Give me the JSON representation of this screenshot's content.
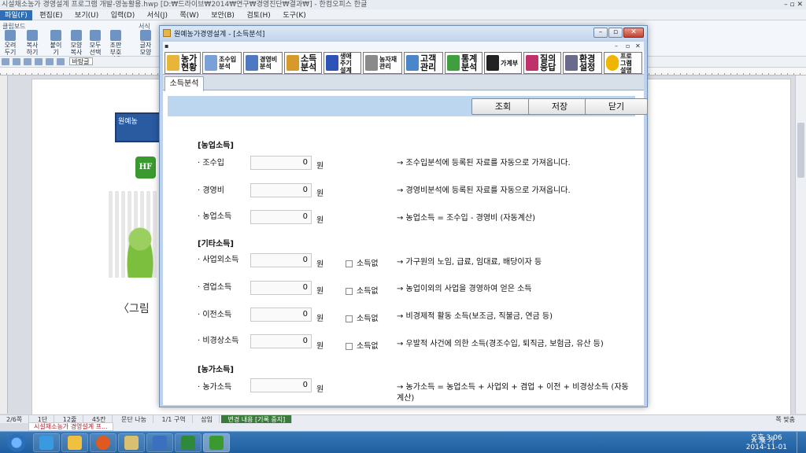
{
  "bg_window": {
    "title": "시설채소농가 경영설계 프로그램 개발-영농활용.hwp [D:₩드라이브₩2014₩연구₩경영진단₩결과₩] - 한컴오피스 한글",
    "menu": [
      "파일(F)",
      "편집(E)",
      "보기(U)",
      "입력(D)",
      "서식(J)",
      "쪽(W)",
      "보안(B)",
      "검토(H)",
      "도구(K)"
    ],
    "ribbon_labels": [
      "클립보드",
      "서식"
    ],
    "ribbon_buttons": [
      "오려두기",
      "복사하기",
      "붙이기",
      "모양복사",
      "모두선택",
      "조판부호지우기",
      "글자모양"
    ],
    "toolbar_field": "바탕글",
    "caption": "〈그림",
    "mini_title": "원예농",
    "logo_text": "HF",
    "status": {
      "page": "2/6쪽",
      "section": "1단",
      "line": "12줄",
      "col": "45칸",
      "paragraph": "문단 나눔",
      "area": "1/1 구역",
      "insert": "삽입",
      "track": "변경 내용 [기록 중지]",
      "doc_tab": "시설채소농가 경영설계 프...",
      "zoom": "쪽 맞춤"
    }
  },
  "taskbar": {
    "tray_text": "A 漢 가",
    "time": "오후 3:06",
    "date": "2014-11-01"
  },
  "dialog": {
    "title": "원예농가경영설계 - [소득분석]",
    "toolbar": [
      {
        "label": "농가\n현황",
        "color": "#e8b53a"
      },
      {
        "label": "조수입\n분석",
        "color": "#7aa0d8"
      },
      {
        "label": "경영비\n분석",
        "color": "#4e78c0"
      },
      {
        "label": "소득\n분석",
        "color": "#d79a2a"
      },
      {
        "label": "생애\n주기\n설계",
        "color": "#2d52b8"
      },
      {
        "label": "농자재\n관리",
        "color": "#8a8a8a"
      },
      {
        "label": "고객\n관리",
        "color": "#4a86c8"
      },
      {
        "label": "통계\n분석",
        "color": "#3f9f3f"
      },
      {
        "label": "가계부",
        "color": "#222222"
      },
      {
        "label": "질의\n응답",
        "color": "#c0306a"
      },
      {
        "label": "환경\n설정",
        "color": "#6a6a8a"
      },
      {
        "label": "프로\n그램\n설명",
        "color": "#f0b500"
      }
    ],
    "tab": "소득분석",
    "buttons": {
      "query": "조회",
      "save": "저장",
      "close": "닫기"
    },
    "sections": {
      "farm": "[농업소득]",
      "other": "[기타소득]",
      "household": "[농가소득]"
    },
    "unit": "원",
    "no_income": "소득없",
    "rows": [
      {
        "label": "· 조수입",
        "value": "0",
        "desc": "→ 조수입분석에 등록된 자료를 자동으로 가져옵니다."
      },
      {
        "label": "· 경영비",
        "value": "0",
        "desc": "→ 경영비분석에 등록된 자료를 자동으로 가져옵니다."
      },
      {
        "label": "· 농업소득",
        "value": "0",
        "desc": "→ 농업소득 = 조수입 - 경영비 (자동계산)"
      },
      {
        "label": "· 사업외소득",
        "value": "0",
        "desc": "→ 가구원의 노임, 급료, 임대료, 배당이자 등"
      },
      {
        "label": "· 겸업소득",
        "value": "0",
        "desc": "→ 농업이외의 사업을 경영하여 얻은 소득"
      },
      {
        "label": "· 이전소득",
        "value": "0",
        "desc": "→ 비경제적 활동 소득(보조금, 직불금, 연금 등)"
      },
      {
        "label": "· 비경상소득",
        "value": "0",
        "desc": "→ 우발적 사건에 의한 소득(경조수입, 퇴직금, 보험금, 유산 등)"
      },
      {
        "label": "· 농가소득",
        "value": "0",
        "desc": "→ 농가소득 = 농업소득 + 사업외 + 겸업 + 이전 + 비경상소득 (자동계산)"
      }
    ]
  }
}
